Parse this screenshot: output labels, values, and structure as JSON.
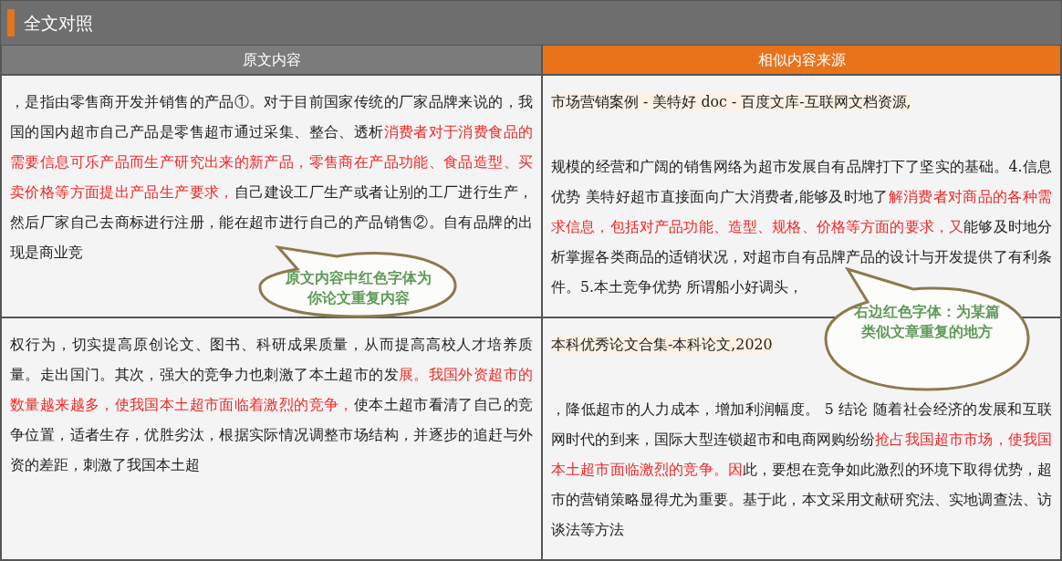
{
  "window": {
    "title": "全文对照"
  },
  "columns": [
    {
      "label": "原文内容",
      "kind": "original"
    },
    {
      "label": "相似内容来源",
      "kind": "source"
    }
  ],
  "rows": [
    {
      "original": [
        {
          "text": "，是指由零售商开发并销售的产品①。对于目前国家传统的厂家品牌来说的，我国的国内超市自己产品是零售超市通过采集、整合、透析",
          "highlighted": false
        },
        {
          "text": "消费者对于消费食品的需要信息可乐产品而生产研究出来的新产品，零售商在产品功能、食品造型、买卖价格等方面提出产品生产要求，",
          "highlighted": true
        },
        {
          "text": "自己建设工厂生产或者让别的工厂进行生产，然后厂家自己去商标进行注册，能在超市进行自己的产品销售②。自有品牌的出现是商业竞",
          "highlighted": false
        }
      ],
      "source_title": "市场营销案例 - 美特好 doc - 百度文库-互联网文档资源,",
      "source": [
        {
          "text": "规模的经营和广阔的销售网络为超市发展自有品牌打下了坚实的基础。4.信息优势 美特好超市直接面向广大消费者,能够及时地了",
          "highlighted": false
        },
        {
          "text": "解消费者对商品的各种需求信息，包括对产品功能、造型、规格、价格等方面的要求，又",
          "highlighted": true
        },
        {
          "text": "能够及时地分析掌握各类商品的适销状况，对超市自有品牌产品的设计与开发提供了有利条件。5.本土竞争优势 所谓船小好调头，",
          "highlighted": false
        }
      ]
    },
    {
      "original": [
        {
          "text": "权行为，切实提高原创论文、图书、科研成果质量，从而提高高校人才培养质量。走出国门。其次，强大的竞争力也刺激了本土超市的发",
          "highlighted": false
        },
        {
          "text": "展。我国外资超市的数量越来越多，使我国本土超市面临着激烈的竞争，",
          "highlighted": true
        },
        {
          "text": "使本土超市看清了自己的竞争位置，适者生存，优胜劣汰，根据实际情况调整市场结构，并逐步的追赶与外资的差距，刺激了我国本土超",
          "highlighted": false
        }
      ],
      "source_title": "本科优秀论文合集-本科论文,2020",
      "source": [
        {
          "text": "，降低超市的人力成本，增加利润幅度。 5 结论 随着社会经济的发展和互联网时代的到来，国际大型连锁超市和电商网购纷纷",
          "highlighted": false
        },
        {
          "text": "抢占我国超市市场，使我国本土超市面临激烈的竞争。因",
          "highlighted": true
        },
        {
          "text": "此，要想在竞争如此激烈的环境下取得优势，超市的营销策略显得尤为重要。基于此，本文采用文献研究法、实地调查法、访谈法等方法",
          "highlighted": false
        }
      ]
    }
  ],
  "callouts": [
    {
      "text": "原文内容中红色字体为你论文重复内容"
    },
    {
      "text": "右边红色字体：为某篇类似文章重复的地方"
    }
  ]
}
